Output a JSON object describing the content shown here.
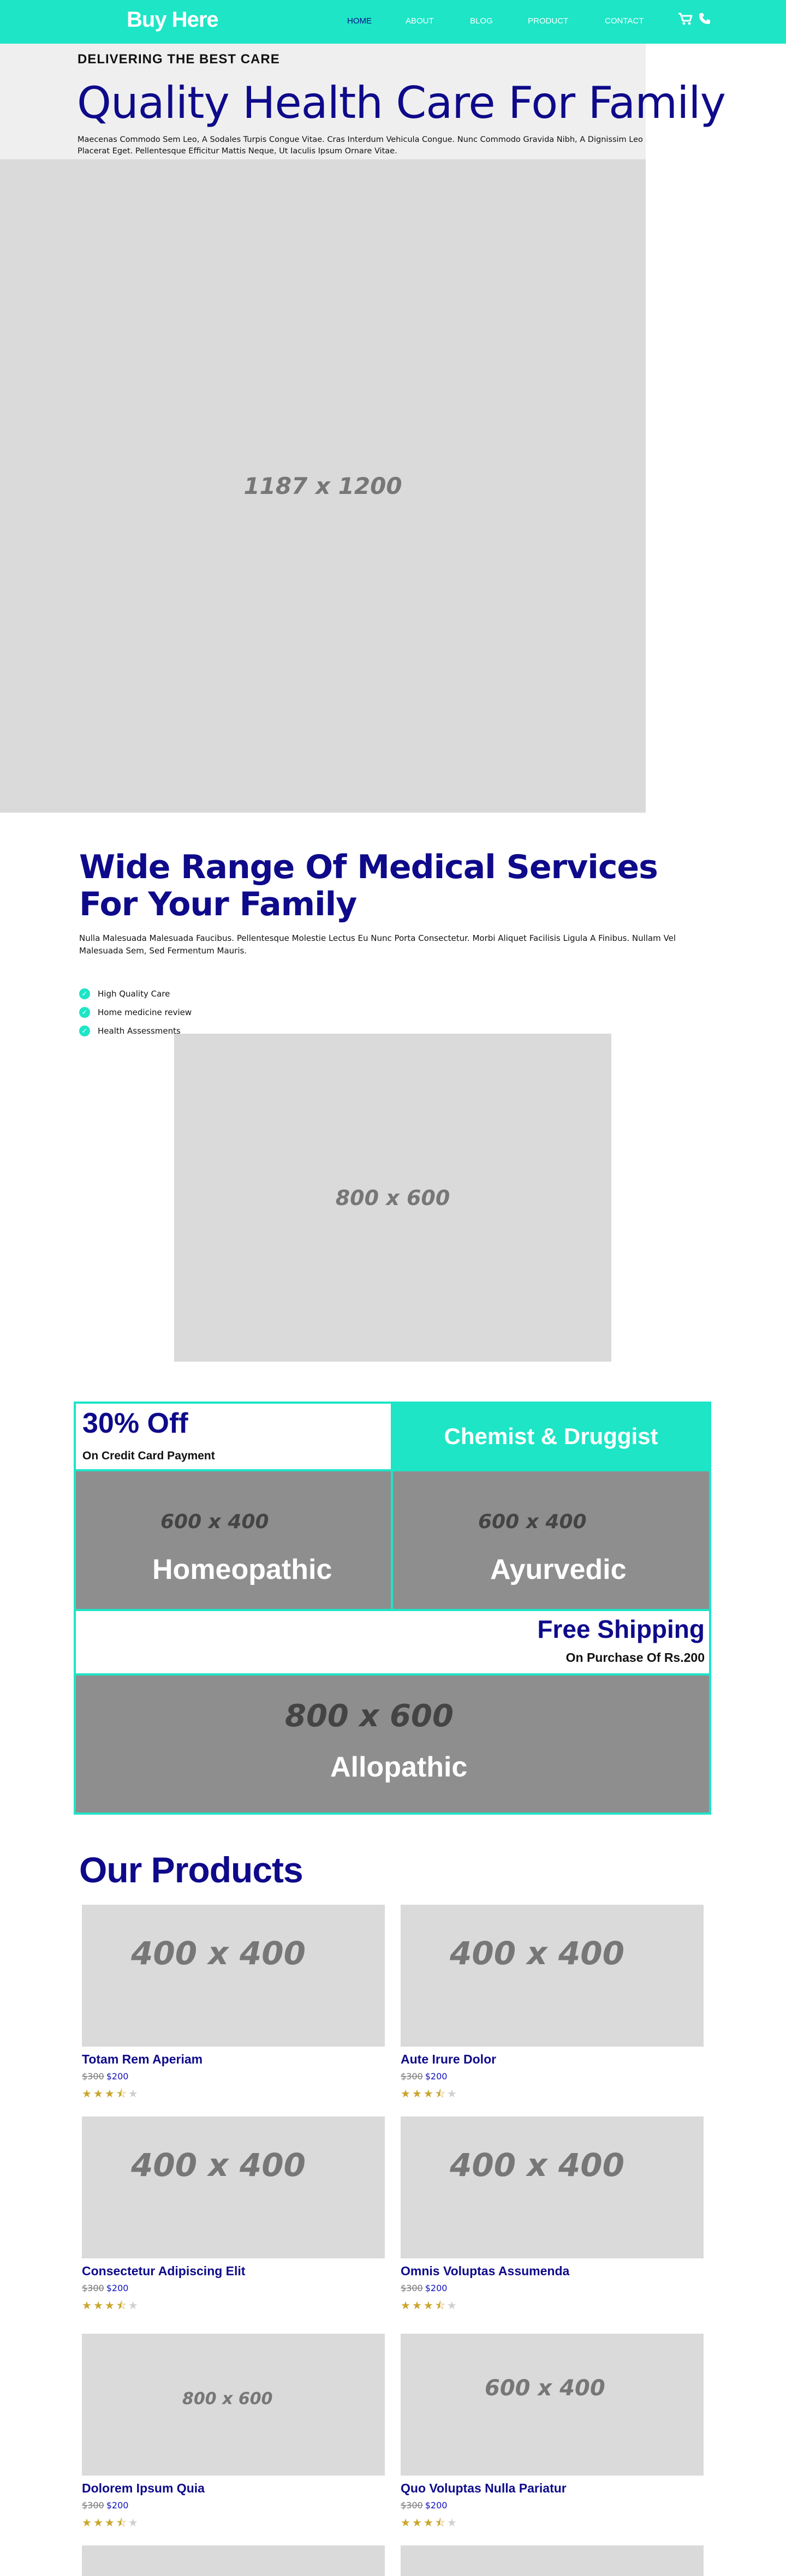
{
  "header": {
    "logo": "Buy Here",
    "nav": [
      "HOME",
      "ABOUT",
      "BLOG",
      "PRODUCT",
      "CONTACT"
    ],
    "active_index": 0,
    "icons": [
      "cart-icon",
      "phone-icon"
    ]
  },
  "hero": {
    "kicker": "DELIVERING THE BEST CARE",
    "title": "Quality Health Care For Family",
    "text": "Maecenas Commodo Sem Leo, A Sodales Turpis Congue Vitae. Cras Interdum Vehicula Congue. Nunc Commodo Gravida Nibh, A Dignissim Leo Placerat Eget. Pellentesque Efficitur Mattis Neque, Ut Iaculis Ipsum Ornare Vitae.",
    "image_label": "1187 x 1200"
  },
  "services": {
    "title": "Wide Range Of Medical Services For Your Family",
    "text": "Nulla Malesuada Malesuada Faucibus. Pellentesque Molestie Lectus Eu Nunc Porta Consectetur. Morbi Aliquet Facilisis Ligula A Finibus. Nullam Vel Malesuada Sem, Sed Fermentum Mauris.",
    "features": [
      "High Quality Care",
      "Home medicine review",
      "Health Assessments"
    ],
    "image_label": "800 x 600"
  },
  "promo": {
    "offer_title": "30% Off",
    "offer_sub": "On Credit Card Payment",
    "chemist": "Chemist & Druggist",
    "homeopathic": {
      "dim": "600 x 400",
      "label": "Homeopathic"
    },
    "ayurvedic": {
      "dim": "600 x 400",
      "label": "Ayurvedic"
    },
    "shipping_title": "Free Shipping",
    "shipping_sub": "On Purchase Of Rs.200",
    "allopathic": {
      "dim": "800 x 600",
      "label": "Allopathic"
    }
  },
  "products": {
    "title": "Our Products",
    "items": [
      {
        "image": "400 x 400",
        "name": "Totam Rem Aperiam",
        "old_price": "$300",
        "new_price": "$200",
        "rating": 3.5
      },
      {
        "image": "400 x 400",
        "name": "Aute Irure Dolor",
        "old_price": "$300",
        "new_price": "$200",
        "rating": 3.5
      },
      {
        "image": "400 x 400",
        "name": "Consectetur Adipiscing Elit",
        "old_price": "$300",
        "new_price": "$200",
        "rating": 3.5
      },
      {
        "image": "400 x 400",
        "name": "Omnis Voluptas Assumenda",
        "old_price": "$300",
        "new_price": "$200",
        "rating": 3.5
      },
      {
        "image": "800 x 600",
        "name": "Dolorem Ipsum Quia",
        "old_price": "$300",
        "new_price": "$200",
        "rating": 3.5
      },
      {
        "image": "600 x 400",
        "name": "Quo Voluptas Nulla Pariatur",
        "old_price": "$300",
        "new_price": "$200",
        "rating": 3.5
      }
    ]
  },
  "colors": {
    "accent": "#1de5c6",
    "brand": "#0e0a8a",
    "placeholder": "#dadada",
    "promo_tile": "#8e8e8e",
    "star": "#c9a52c"
  }
}
